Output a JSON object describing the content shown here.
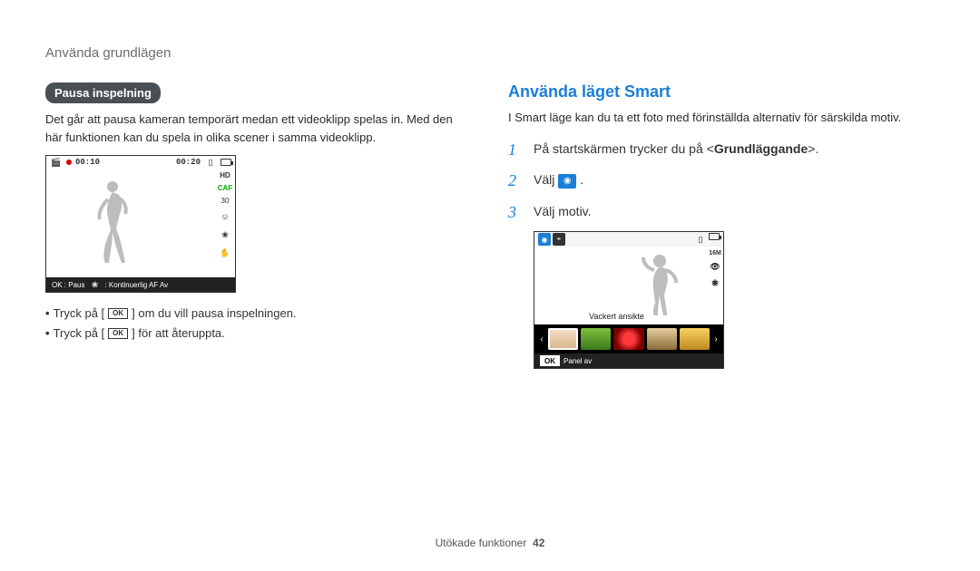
{
  "breadcrumb": "Använda grundlägen",
  "left": {
    "pill": "Pausa inspelning",
    "intro": "Det går att pausa kameran temporärt medan ett videoklipp spelas in. Med den här funktionen kan du spela in olika scener i samma videoklipp.",
    "screenshot1": {
      "time_elapsed": "00:10",
      "time_total": "00:20",
      "hd_label": "HD",
      "fps_label": "30",
      "caf_label": "CAF",
      "footer_ok": "OK : Paus",
      "footer_af": ": Kontinuerlig AF Av"
    },
    "bullets": {
      "b1_pre": "Tryck på [",
      "b1_post": "] om du vill pausa inspelningen.",
      "b2_pre": "Tryck på [",
      "b2_post": "] för att återuppta.",
      "ok": "OK"
    }
  },
  "right": {
    "heading": "Använda läget Smart",
    "intro": "I Smart läge kan du ta ett foto med förinställda alternativ för särskilda motiv.",
    "steps": {
      "s1_n": "1",
      "s1_t_pre": "På startskärmen trycker du på <",
      "s1_t_bold": "Grundläggande",
      "s1_t_post": ">.",
      "s2_n": "2",
      "s2_t_pre": "Välj ",
      "s2_t_post": ".",
      "s3_n": "3",
      "s3_t": "Välj motiv."
    },
    "screenshot2": {
      "res_label": "16M",
      "scene_label": "Vackert ansikte",
      "footer_ok": "OK",
      "footer_text": "Panel av",
      "thumbs": [
        {
          "bg": "linear-gradient(#f6e0c8,#d8b48a)"
        },
        {
          "bg": "linear-gradient(#7fbf3f,#3a7a1a)"
        },
        {
          "bg": "radial-gradient(circle,#ff3a3a 30%,#7a0000 70%)"
        },
        {
          "bg": "linear-gradient(#e8cfa0,#8a6a3a)"
        },
        {
          "bg": "linear-gradient(#f8d060,#c08a20)"
        }
      ]
    }
  },
  "footer": {
    "label": "Utökade funktioner",
    "page": "42"
  }
}
